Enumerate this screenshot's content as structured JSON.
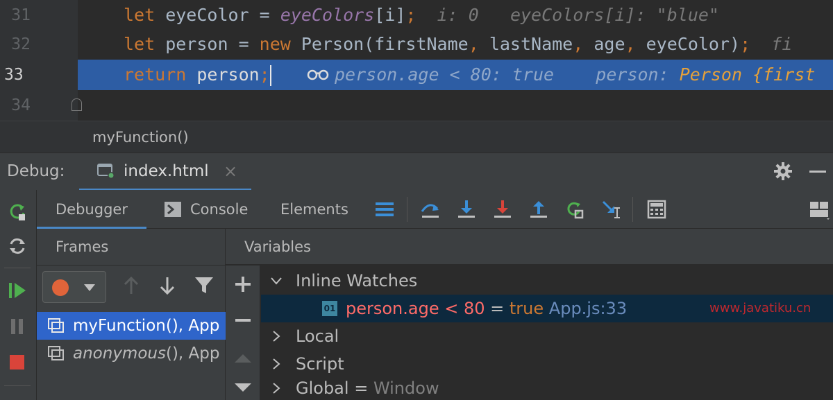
{
  "editor": {
    "lines": [
      {
        "num": "31"
      },
      {
        "num": "32"
      },
      {
        "num": "33"
      },
      {
        "num": "34"
      }
    ],
    "line31": {
      "kw": "let",
      "name": " eyeColor = ",
      "arr": "eyeColors",
      "idx": "[i]",
      "semi": ";",
      "hint1": "i: 0",
      "hint2": "eyeColors[i]: \"blue\""
    },
    "line32": {
      "kw": "let",
      "name": " person = ",
      "new": "new",
      "ctor": " Person(firstName",
      "c1": ",",
      "a2": " lastName",
      "c2": ",",
      "a3": " age",
      "c3": ",",
      "a4": " eyeColor)",
      "semi": ";",
      "hint": "fi"
    },
    "line33": {
      "kw": "return",
      "name": " person",
      "semi": ";",
      "watch_hint": "person.age < 80: true",
      "obj_hint_name": "person: ",
      "obj_hint_val": "Person {first"
    }
  },
  "breadcrumb": {
    "label": "myFunction()"
  },
  "debug": {
    "label": "Debug:",
    "tab_label": "index.html",
    "close": "×"
  },
  "tabs": {
    "debugger": "Debugger",
    "console": "Console",
    "elements": "Elements"
  },
  "frames": {
    "title": "Frames",
    "items": [
      {
        "name": "myFunction",
        "suffix": "(), App"
      },
      {
        "name": "anonymous",
        "suffix": "(), App"
      }
    ]
  },
  "variables": {
    "title": "Variables",
    "inline_watches": "Inline Watches",
    "watch": {
      "badge": "01",
      "expr": "person.age < 80",
      "eq": " = ",
      "val": "true",
      "loc": " App.js:33"
    },
    "local": "Local",
    "script": "Script",
    "global_name": "Global",
    "global_eq": " = ",
    "global_val": "Window"
  },
  "watermark": "www.javatiku.cn",
  "colors": {
    "accent": "#4a88c7",
    "selection": "#2f65ca",
    "exec_line": "#2d5da4",
    "resume_green": "#4fb04f",
    "stop_red": "#d9443a"
  }
}
